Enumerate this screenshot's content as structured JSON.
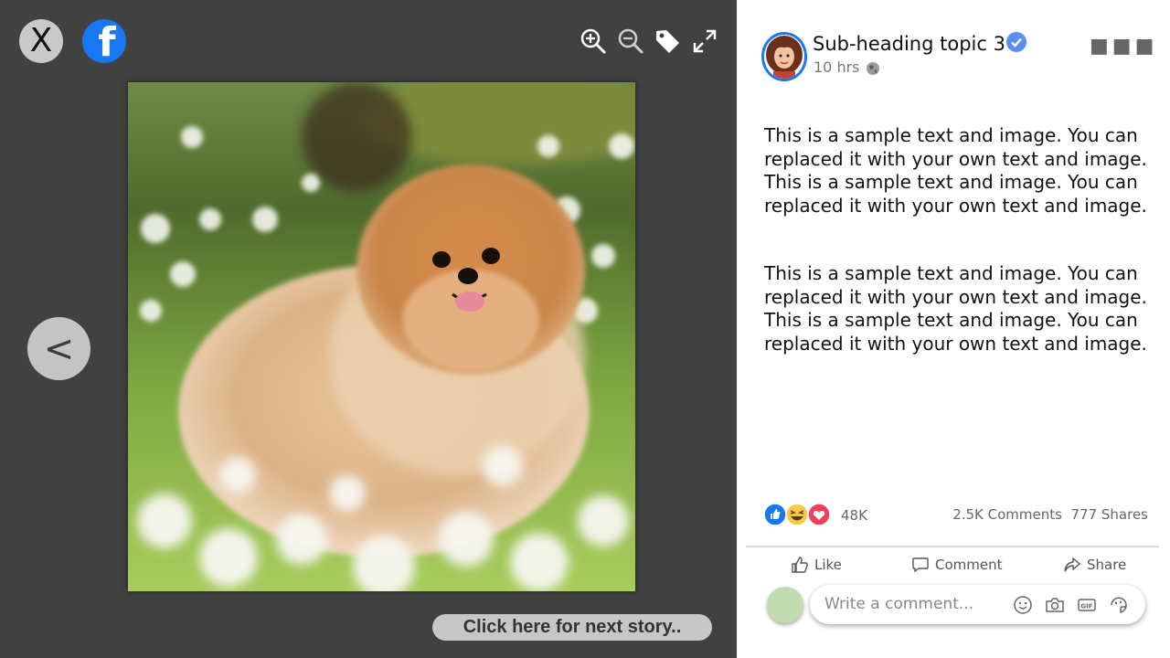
{
  "viewer": {
    "close_label": "X",
    "brand_glyph": "f",
    "prev_label": "<",
    "next_story_label": "Click  here for next story..",
    "tools": [
      "zoom-in-icon",
      "zoom-out-icon",
      "tag-icon",
      "fullscreen-icon"
    ]
  },
  "post": {
    "author": "Sub-heading topic 3",
    "time": "10 hrs",
    "paragraphs": [
      "This is a sample text and image. You can replaced it with your own text and image. This is a sample text and image. You can replaced it with your own text and image.",
      "This is a sample text and image. You can replaced it with your own text and image. This is a sample text and image. You can replaced it with your own text and image."
    ],
    "reaction_count": "48K",
    "comments": "2.5K Comments",
    "shares": "777 Shares",
    "actions": {
      "like": "Like",
      "comment": "Comment",
      "share": "Share"
    },
    "comment_placeholder": "Write a comment..."
  },
  "colors": {
    "brand": "#1877f2",
    "viewer_bg": "#414141",
    "panel_bg": "#ffffff"
  }
}
